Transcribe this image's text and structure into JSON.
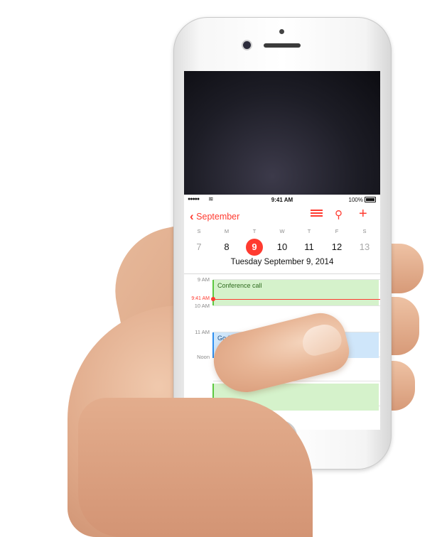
{
  "statusbar": {
    "time": "9:41 AM",
    "battery": "100%"
  },
  "navbar": {
    "back_label": "September"
  },
  "week": {
    "days": [
      {
        "dow": "S",
        "num": "7"
      },
      {
        "dow": "M",
        "num": "8"
      },
      {
        "dow": "T",
        "num": "9"
      },
      {
        "dow": "W",
        "num": "10"
      },
      {
        "dow": "T",
        "num": "11"
      },
      {
        "dow": "F",
        "num": "12"
      },
      {
        "dow": "S",
        "num": "13"
      }
    ],
    "selected_label": "Tuesday  September 9, 2014"
  },
  "timeline": {
    "hours": [
      "9 AM",
      "10 AM",
      "11 AM",
      "Noon"
    ],
    "now_label": "9:41 AM",
    "events": [
      {
        "title": "Conference call",
        "color": "green"
      },
      {
        "title": "Go for",
        "color": "blue"
      },
      {
        "title": "",
        "color": "green"
      }
    ]
  },
  "colors": {
    "accent": "#ff3b30",
    "event_green": "#d5f2cb",
    "event_blue": "#cfe6fa"
  },
  "icons": [
    "chevron-left-icon",
    "list-icon",
    "search-icon",
    "add-icon",
    "wifi-icon",
    "battery-icon"
  ]
}
